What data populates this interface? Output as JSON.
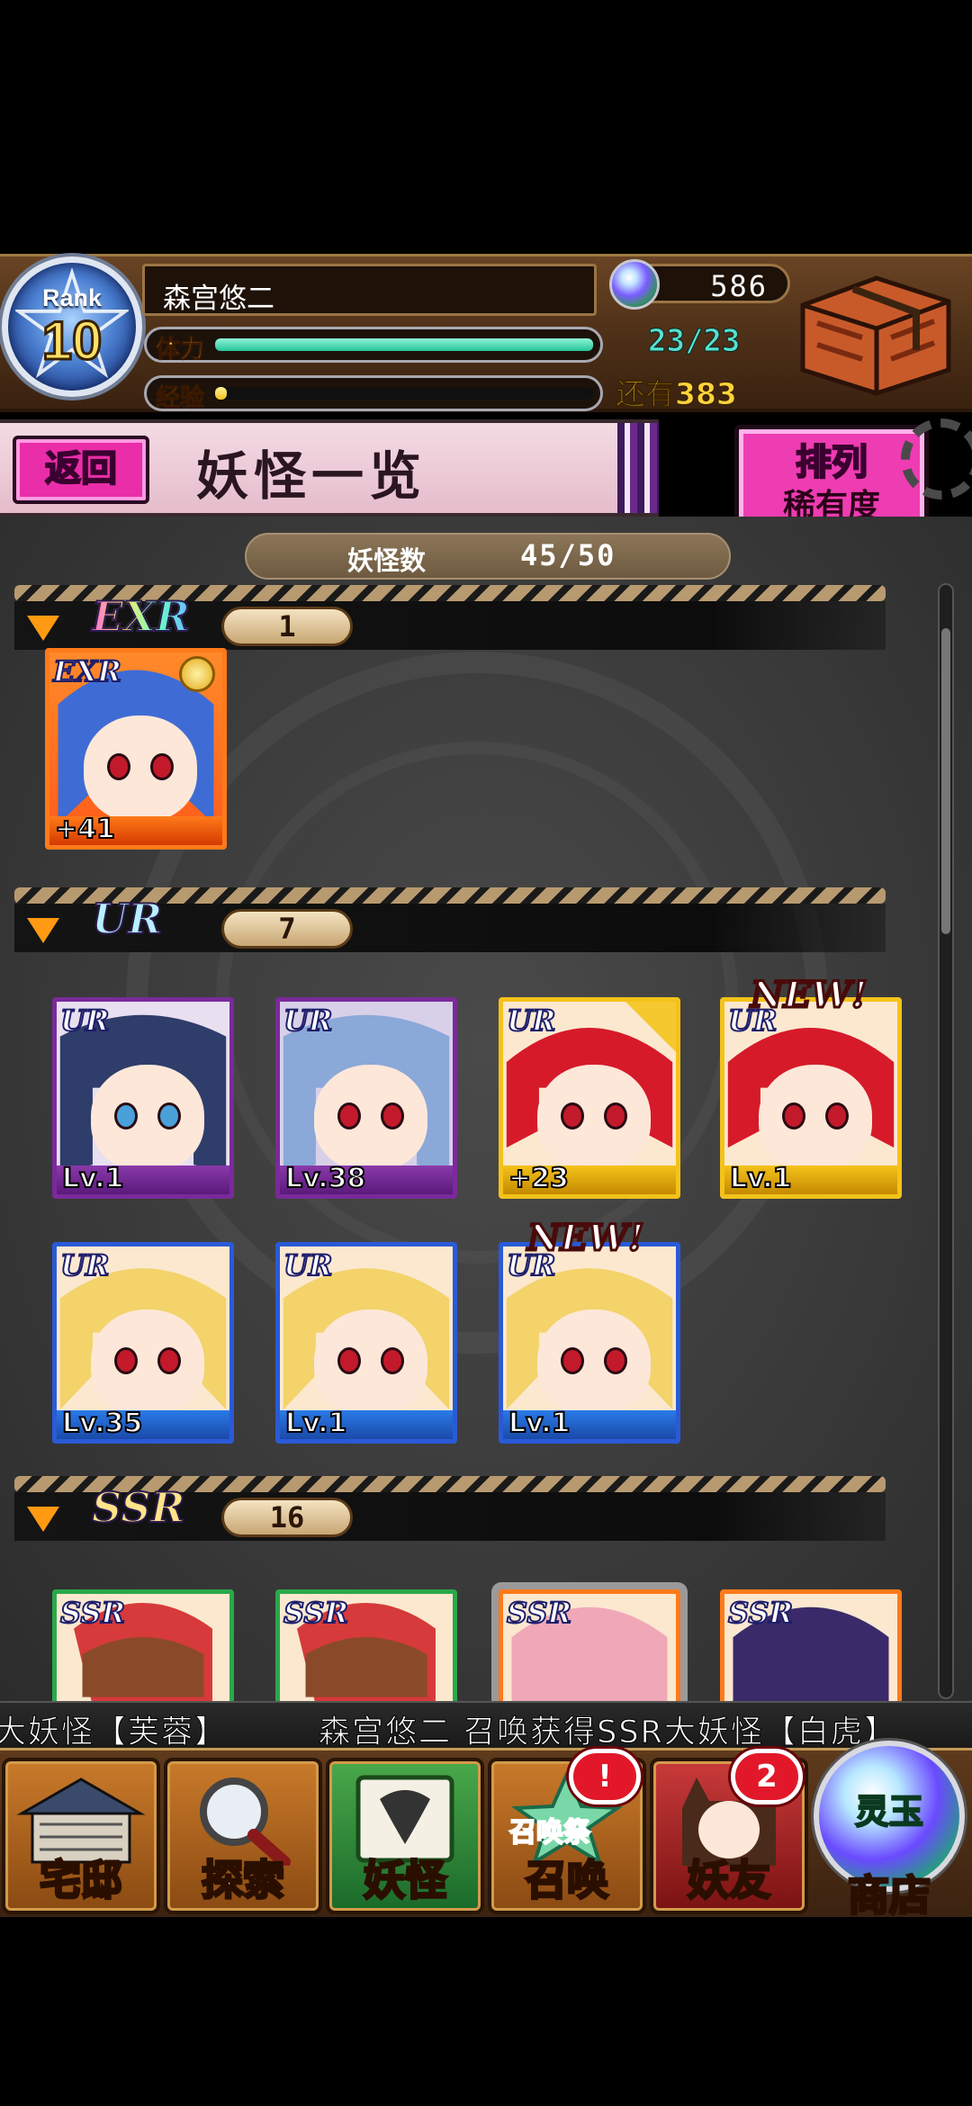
{
  "header": {
    "rank_label": "Rank",
    "rank_value": "10",
    "player_name": "森宫悠二",
    "stamina_label": "体力",
    "stamina_value": "23/23",
    "stamina_fraction": 1.0,
    "exp_label": "经验",
    "exp_remaining": "还有383",
    "exp_fraction": 0.03,
    "gems": "586"
  },
  "toolbar": {
    "back_label": "返回",
    "title": "妖怪一览",
    "sort_label": "排列",
    "sort_value": "稀有度"
  },
  "list": {
    "count_label": "妖怪数",
    "count_value": "45/50",
    "sections": [
      {
        "rarity": "EXR",
        "count": "1",
        "cards": [
          {
            "tag": "EXR",
            "level": "+41"
          }
        ]
      },
      {
        "rarity": "UR",
        "count": "7",
        "cards": [
          {
            "tag": "UR",
            "level": "Lv.1"
          },
          {
            "tag": "UR",
            "level": "Lv.38"
          },
          {
            "tag": "UR",
            "level": "+23"
          },
          {
            "tag": "UR",
            "level": "Lv.1",
            "badge": "NEW!"
          },
          {
            "tag": "UR",
            "level": "Lv.35"
          },
          {
            "tag": "UR",
            "level": "Lv.1"
          },
          {
            "tag": "UR",
            "level": "Lv.1",
            "badge": "NEW!"
          }
        ]
      },
      {
        "rarity": "SSR",
        "count": "16",
        "cards": [
          {
            "tag": "SSR"
          },
          {
            "tag": "SSR"
          },
          {
            "tag": "SSR"
          },
          {
            "tag": "SSR"
          }
        ]
      }
    ]
  },
  "ticker": {
    "left": "大妖怪【芙蓉】",
    "right": "森宫悠二 召唤获得SSR大妖怪【白虎】"
  },
  "nav": {
    "items": [
      {
        "label": "宅邸"
      },
      {
        "label": "探索"
      },
      {
        "label": "妖怪"
      },
      {
        "label": "召唤",
        "badge": "!",
        "sub": "召唤祭"
      },
      {
        "label": "妖友",
        "badge": "2"
      },
      {
        "label": "商店",
        "sub": "灵玉"
      }
    ]
  },
  "colors": {
    "accent_pink": "#ea2da8",
    "stamina": "#25c49a",
    "exp": "#f4c21a",
    "ur_frame": "#7a2a9a",
    "ur_frame_gold": "#f4c21a",
    "ur_frame_blue": "#2a5ad8",
    "ssr_frame_green": "#2aa84a",
    "ssr_frame_orange": "#ff7a1a"
  },
  "icons": [
    "rank-star-icon",
    "gem-icon",
    "chest-icon",
    "gear-icon",
    "collapse-triangle-icon",
    "medal-icon"
  ]
}
